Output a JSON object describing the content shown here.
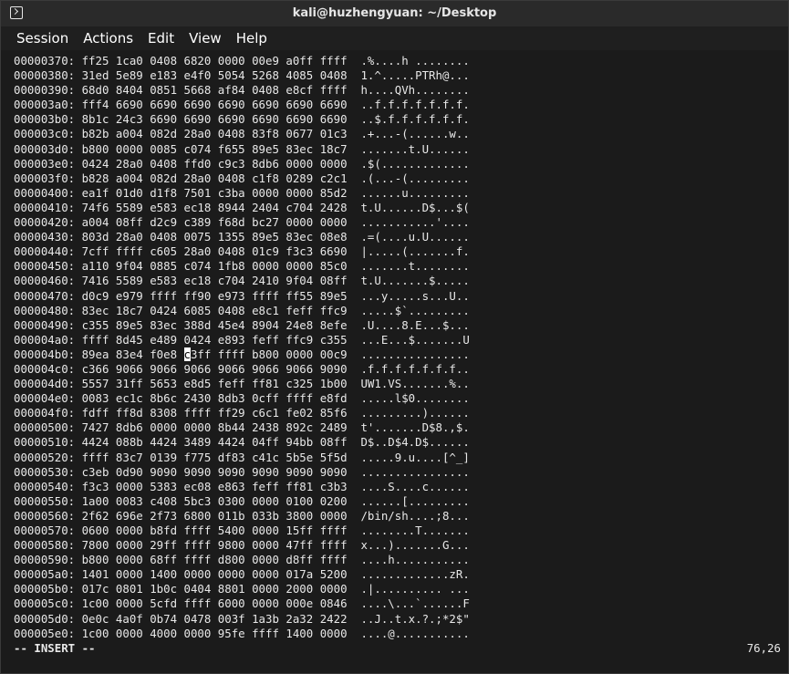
{
  "window": {
    "title": "kali@huzhengyuan: ~/Desktop"
  },
  "menu": {
    "items": [
      "Session",
      "Actions",
      "Edit",
      "View",
      "Help"
    ]
  },
  "hexdump": {
    "lines": [
      "00000370: ff25 1ca0 0408 6820 0000 00e9 a0ff ffff  .%....h ........",
      "00000380: 31ed 5e89 e183 e4f0 5054 5268 4085 0408  1.^.....PTRh@...",
      "00000390: 68d0 8404 0851 5668 af84 0408 e8cf ffff  h....QVh........",
      "000003a0: fff4 6690 6690 6690 6690 6690 6690 6690  ..f.f.f.f.f.f.f.",
      "000003b0: 8b1c 24c3 6690 6690 6690 6690 6690 6690  ..$.f.f.f.f.f.f.",
      "000003c0: b82b a004 082d 28a0 0408 83f8 0677 01c3  .+...-(......w..",
      "000003d0: b800 0000 0085 c074 f655 89e5 83ec 18c7  .......t.U......",
      "000003e0: 0424 28a0 0408 ffd0 c9c3 8db6 0000 0000  .$(.............",
      "000003f0: b828 a004 082d 28a0 0408 c1f8 0289 c2c1  .(...-(.........",
      "00000400: ea1f 01d0 d1f8 7501 c3ba 0000 0000 85d2  ......u.........",
      "00000410: 74f6 5589 e583 ec18 8944 2404 c704 2428  t.U......D$...$(",
      "00000420: a004 08ff d2c9 c389 f68d bc27 0000 0000  ...........'....",
      "00000430: 803d 28a0 0408 0075 1355 89e5 83ec 08e8  .=(....u.U......",
      "00000440: 7cff ffff c605 28a0 0408 01c9 f3c3 6690  |.....(.......f.",
      "00000450: a110 9f04 0885 c074 1fb8 0000 0000 85c0  .......t........",
      "00000460: 7416 5589 e583 ec18 c704 2410 9f04 08ff  t.U.......$.....",
      "00000470: d0c9 e979 ffff ff90 e973 ffff ff55 89e5  ...y.....s...U..",
      "00000480: 83ec 18c7 0424 6085 0408 e8c1 feff ffc9  .....$`.........",
      "00000490: c355 89e5 83ec 388d 45e4 8904 24e8 8efe  .U....8.E...$...",
      "000004a0: ffff 8d45 e489 0424 e893 feff ffc9 c355  ...E...$.......U",
      "000004b0: 89ea 83e4 f0e8 c3ff ffff b800 0000 00c9  ................",
      "000004c0: c366 9066 9066 9066 9066 9066 9066 9090  .f.f.f.f.f.f.f..",
      "000004d0: 5557 31ff 5653 e8d5 feff ff81 c325 1b00  UW1.VS.......%..",
      "000004e0: 0083 ec1c 8b6c 2430 8db3 0cff ffff e8fd  .....l$0........",
      "000004f0: fdff ff8d 8308 ffff ff29 c6c1 fe02 85f6  .........)......",
      "00000500: 7427 8db6 0000 0000 8b44 2438 892c 2489  t'.......D$8.,$.",
      "00000510: 4424 088b 4424 3489 4424 04ff 94bb 08ff  D$..D$4.D$......",
      "00000520: ffff 83c7 0139 f775 df83 c41c 5b5e 5f5d  .....9.u....[^_]",
      "00000530: c3eb 0d90 9090 9090 9090 9090 9090 9090  ................",
      "00000540: f3c3 0000 5383 ec08 e863 feff ff81 c3b3  ....S....c......",
      "00000550: 1a00 0083 c408 5bc3 0300 0000 0100 0200  ......[.........",
      "00000560: 2f62 696e 2f73 6800 011b 033b 3800 0000  /bin/sh....;8...",
      "00000570: 0600 0000 b8fd ffff 5400 0000 15ff ffff  ........T.......",
      "00000580: 7800 0000 29ff ffff 9800 0000 47ff ffff  x...).......G...",
      "00000590: b800 0000 68ff ffff d800 0000 d8ff ffff  ....h...........",
      "000005a0: 1401 0000 1400 0000 0000 0000 017a 5200  .............zR.",
      "000005b0: 017c 0801 1b0c 0404 8801 0000 2000 0000  .|.......... ...",
      "000005c0: 1c00 0000 5cfd ffff 6000 0000 000e 0846  ....\\...`......F",
      "000005d0: 0e0c 4a0f 0b74 0478 003f 1a3b 2a32 2422  ..J..t.x.?.;*2$\"",
      "000005e0: 1c00 0000 4000 0000 95fe ffff 1400 0000  ....@..........."
    ],
    "cursor_line": 20,
    "cursor_before": "000004b0: 89ea 83e4 f0e8 ",
    "cursor_char": "c",
    "cursor_after": "3ff ffff b800 0000 00c9  ................"
  },
  "status": {
    "mode": "-- INSERT --",
    "position": "76,26"
  }
}
